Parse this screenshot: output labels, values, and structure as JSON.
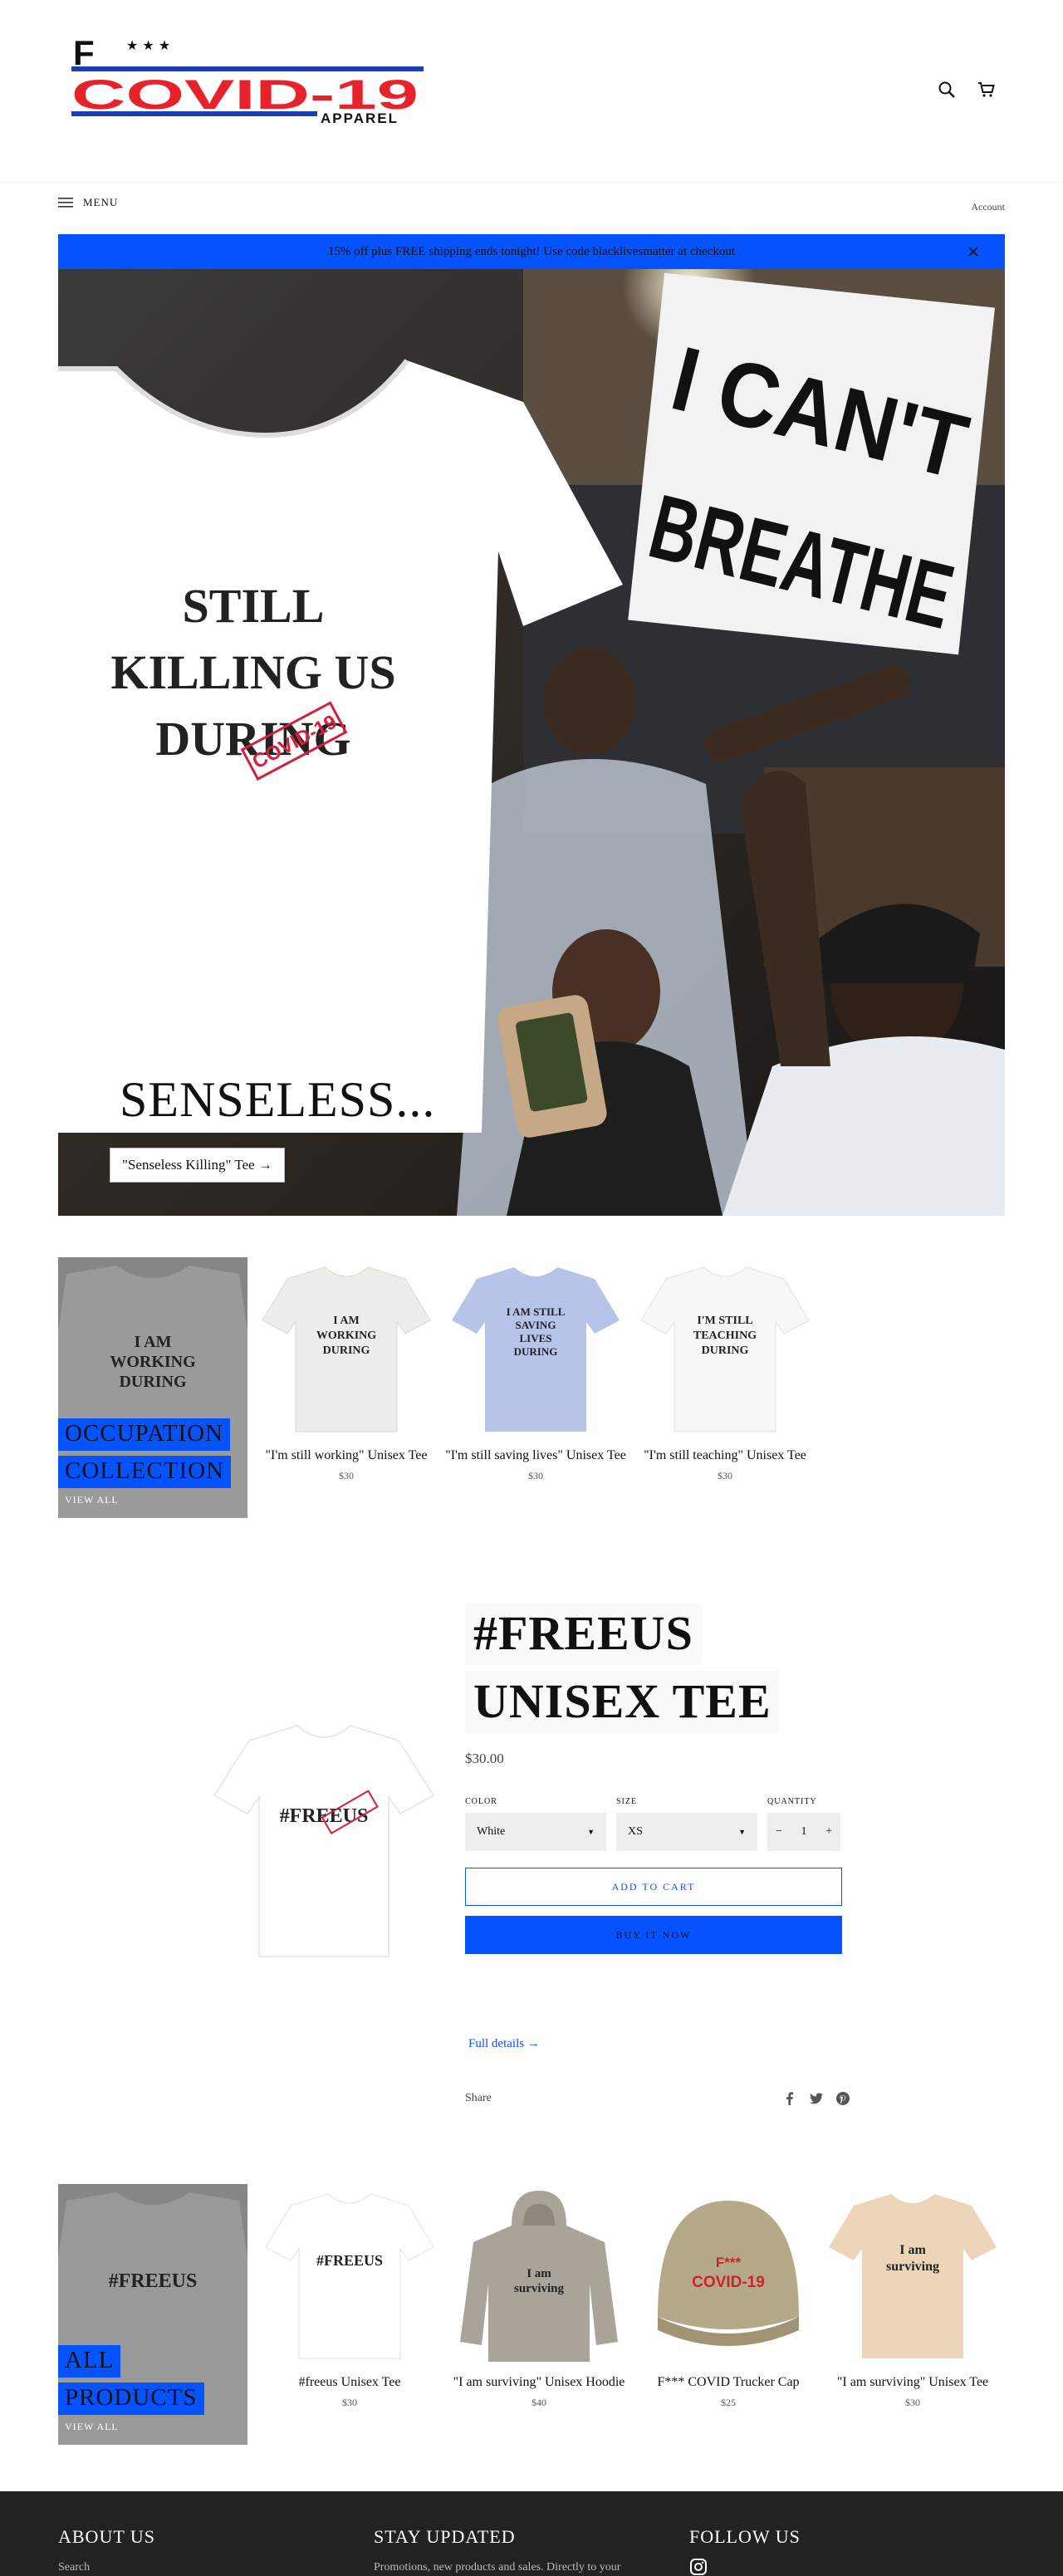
{
  "logo": {
    "top_text": "F",
    "stars": "★ ★ ★",
    "main_text": "COVID-19",
    "sub_text": "APPAREL"
  },
  "header": {
    "search_icon": "search-icon",
    "cart_icon": "cart-icon",
    "menu_label": "MENU",
    "account_label": "Account"
  },
  "announcement": {
    "text": "15% off plus FREE shipping ends tonight! Use code blacklivesmatter at checkout",
    "close_icon": "close-icon"
  },
  "hero": {
    "title": "SENSELESS...",
    "button_label": "\"Senseless Killing\" Tee →",
    "shirt_lines": [
      "STILL",
      "KILLING US",
      "DURING"
    ],
    "shirt_stamp": "COVID-19",
    "sign_lines": [
      "I CAN'T",
      "BREATHE"
    ]
  },
  "collection1": {
    "card_shirt_lines": [
      "I AM",
      "WORKING",
      "DURING"
    ],
    "label_lines": [
      "OCCUPATION",
      "COLLECTION"
    ],
    "view_all": "VIEW ALL",
    "products": [
      {
        "name": "\"I'm still working\" Unisex Tee",
        "price": "$30",
        "shirt_lines": [
          "I AM",
          "WORKING",
          "DURING"
        ],
        "shirt_color": "#ededea"
      },
      {
        "name": "\"I'm still saving lives\" Unisex Tee",
        "price": "$30",
        "shirt_lines": [
          "I AM STILL",
          "SAVING",
          "LIVES",
          "DURING"
        ],
        "shirt_color": "#b7c4ea"
      },
      {
        "name": "\"I'm still teaching\" Unisex Tee",
        "price": "$30",
        "shirt_lines": [
          "I'M STILL",
          "TEACHING",
          "DURING"
        ],
        "shirt_color": "#f7f7f7"
      }
    ]
  },
  "featured": {
    "title_lines": [
      "#FREEUS",
      "UNISEX TEE"
    ],
    "price": "$30.00",
    "shirt_text": "#FREEUS",
    "color_label": "COLOR",
    "color_value": "White",
    "size_label": "SIZE",
    "size_value": "XS",
    "quantity_label": "QUANTITY",
    "quantity_minus": "−",
    "quantity_value": "1",
    "quantity_plus": "+",
    "add_to_cart": "ADD TO CART",
    "buy_now": "BUY IT NOW",
    "full_details": "Full details →",
    "share_label": "Share",
    "share_icons": [
      "facebook-icon",
      "twitter-icon",
      "pinterest-icon"
    ]
  },
  "collection2": {
    "card_shirt_text": "#FREEUS",
    "label_lines": [
      "ALL",
      "PRODUCTS"
    ],
    "view_all": "VIEW ALL",
    "products": [
      {
        "name": "#freeus Unisex Tee",
        "price": "$30",
        "kind": "tee",
        "shirt_lines": [
          "#FREEUS"
        ],
        "shirt_color": "#ffffff"
      },
      {
        "name": "\"I am surviving\" Unisex Hoodie",
        "price": "$40",
        "kind": "hoodie",
        "shirt_lines": [
          "I am",
          "surviving"
        ],
        "shirt_color": "#a9a39a"
      },
      {
        "name": "F*** COVID Trucker Cap",
        "price": "$25",
        "kind": "cap",
        "shirt_lines": [
          "F***",
          "COVID-19"
        ],
        "shirt_color": "#b5a98a"
      },
      {
        "name": "\"I am surviving\" Unisex Tee",
        "price": "$30",
        "kind": "tee",
        "shirt_lines": [
          "I am",
          "surviving"
        ],
        "shirt_color": "#ecd5b8"
      }
    ]
  },
  "footer": {
    "about_title": "ABOUT US",
    "about_link": "Search",
    "updates_title": "STAY UPDATED",
    "updates_text": "Promotions, new products and sales. Directly to your",
    "follow_title": "FOLLOW US",
    "instagram_icon": "instagram-icon"
  },
  "colors": {
    "accent": "#0553ff",
    "logo_red": "#e8222b",
    "footer_bg": "#222222"
  }
}
